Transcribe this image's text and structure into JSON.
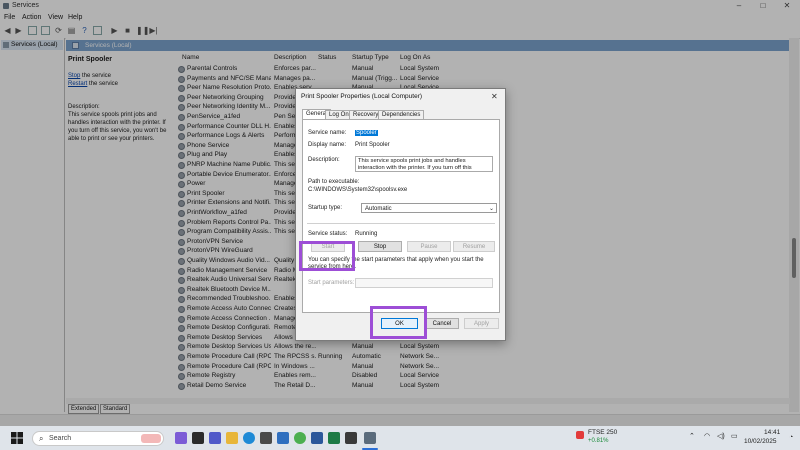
{
  "window": {
    "title": "Services",
    "controls": [
      "–",
      "□",
      "✕"
    ]
  },
  "menu": [
    "File",
    "Action",
    "View",
    "Help"
  ],
  "tree": {
    "root": "Services (Local)"
  },
  "pane": {
    "header": "Services (Local)"
  },
  "extended": {
    "service_name": "Print Spooler",
    "stop_link": "Stop",
    "stop_suffix": " the service",
    "restart_link": "Restart",
    "restart_suffix": " the service",
    "description_label": "Description:",
    "description": "This service spools print jobs and handles interaction with the printer. If you turn off this service, you won't be able to print or see your printers."
  },
  "columns": [
    "Name",
    "Description",
    "Status",
    "Startup Type",
    "Log On As"
  ],
  "services": [
    {
      "name": "Parental Controls",
      "desc": "Enforces par...",
      "status": "",
      "startup": "Manual",
      "logon": "Local System"
    },
    {
      "name": "Payments and NFC/SE Mana...",
      "desc": "Manages pa...",
      "status": "",
      "startup": "Manual (Trigg...",
      "logon": "Local Service"
    },
    {
      "name": "Peer Name Resolution Proto...",
      "desc": "Enables serv...",
      "status": "",
      "startup": "Manual",
      "logon": "Local Service"
    },
    {
      "name": "Peer Networking Grouping",
      "desc": "Provides ne...",
      "status": "",
      "startup": "Manual",
      "logon": "Local Service"
    },
    {
      "name": "Peer Networking Identity M...",
      "desc": "Provides ide...",
      "status": "",
      "startup": "Manual",
      "logon": "Local Service"
    },
    {
      "name": "PenService_a1fed",
      "desc": "Pen Service",
      "status": "",
      "startup": "",
      "logon": ""
    },
    {
      "name": "Performance Counter DLL H...",
      "desc": "Enables rem...",
      "status": "",
      "startup": "",
      "logon": ""
    },
    {
      "name": "Performance Logs & Alerts",
      "desc": "Performance...",
      "status": "",
      "startup": "",
      "logon": ""
    },
    {
      "name": "Phone Service",
      "desc": "Manages th...",
      "status": "",
      "startup": "",
      "logon": ""
    },
    {
      "name": "Plug and Play",
      "desc": "Enables a co...",
      "status": "",
      "startup": "",
      "logon": ""
    },
    {
      "name": "PNRP Machine Name Public...",
      "desc": "This service ...",
      "status": "",
      "startup": "",
      "logon": ""
    },
    {
      "name": "Portable Device Enumerator...",
      "desc": "Enforces gr...",
      "status": "",
      "startup": "",
      "logon": ""
    },
    {
      "name": "Power",
      "desc": "Manages po...",
      "status": "",
      "startup": "",
      "logon": ""
    },
    {
      "name": "Print Spooler",
      "desc": "This service ...",
      "status": "",
      "startup": "",
      "logon": ""
    },
    {
      "name": "Printer Extensions and Notifi...",
      "desc": "This service ...",
      "status": "",
      "startup": "",
      "logon": ""
    },
    {
      "name": "PrintWorkflow_a1fed",
      "desc": "Provides su...",
      "status": "",
      "startup": "",
      "logon": ""
    },
    {
      "name": "Problem Reports Control Pa...",
      "desc": "This service ...",
      "status": "",
      "startup": "",
      "logon": ""
    },
    {
      "name": "Program Compatibility Assis...",
      "desc": "This service ...",
      "status": "",
      "startup": "",
      "logon": ""
    },
    {
      "name": "ProtonVPN Service",
      "desc": "",
      "status": "",
      "startup": "",
      "logon": ""
    },
    {
      "name": "ProtonVPN WireGuard",
      "desc": "",
      "status": "",
      "startup": "",
      "logon": ""
    },
    {
      "name": "Quality Windows Audio Vid...",
      "desc": "Quality Win...",
      "status": "",
      "startup": "",
      "logon": ""
    },
    {
      "name": "Radio Management Service",
      "desc": "Radio Mana...",
      "status": "",
      "startup": "",
      "logon": ""
    },
    {
      "name": "Realtek Audio Universal Serv...",
      "desc": "Realtek Aud...",
      "status": "",
      "startup": "",
      "logon": ""
    },
    {
      "name": "Realtek Bluetooth Device M...",
      "desc": "",
      "status": "",
      "startup": "",
      "logon": ""
    },
    {
      "name": "Recommended Troubleshoo...",
      "desc": "Enables aut...",
      "status": "",
      "startup": "",
      "logon": ""
    },
    {
      "name": "Remote Access Auto Connec...",
      "desc": "Creates a co...",
      "status": "",
      "startup": "",
      "logon": ""
    },
    {
      "name": "Remote Access Connection ...",
      "desc": "Manages di...",
      "status": "",
      "startup": "",
      "logon": ""
    },
    {
      "name": "Remote Desktop Configurati...",
      "desc": "Remote Des...",
      "status": "",
      "startup": "",
      "logon": ""
    },
    {
      "name": "Remote Desktop Services",
      "desc": "Allows users ...",
      "status": "",
      "startup": "Manual",
      "logon": "Network Se..."
    },
    {
      "name": "Remote Desktop Services Us...",
      "desc": "Allows the re...",
      "status": "",
      "startup": "Manual",
      "logon": "Local System"
    },
    {
      "name": "Remote Procedure Call (RPC)",
      "desc": "The RPCSS s...",
      "status": "Running",
      "startup": "Automatic",
      "logon": "Network Se..."
    },
    {
      "name": "Remote Procedure Call (RPC)...",
      "desc": "In Windows ...",
      "status": "",
      "startup": "Manual",
      "logon": "Network Se..."
    },
    {
      "name": "Remote Registry",
      "desc": "Enables rem...",
      "status": "",
      "startup": "Disabled",
      "logon": "Local Service"
    },
    {
      "name": "Retail Demo Service",
      "desc": "The Retail D...",
      "status": "",
      "startup": "Manual",
      "logon": "Local System"
    }
  ],
  "bottom_tabs": [
    "Extended",
    "Standard"
  ],
  "dialog": {
    "title": "Print Spooler Properties (Local Computer)",
    "close": "✕",
    "tabs": [
      "General",
      "Log On",
      "Recovery",
      "Dependencies"
    ],
    "service_name_label": "Service name:",
    "service_name": "Spooler",
    "display_name_label": "Display name:",
    "display_name": "Print Spooler",
    "description_label": "Description:",
    "description": "This service spools print jobs and handles interaction with the printer. If you turn off this service, you won't be able to print or see your printers.",
    "path_label": "Path to executable:",
    "path": "C:\\WINDOWS\\System32\\spoolsv.exe",
    "startup_label": "Startup type:",
    "startup_value": "Automatic",
    "status_label": "Service status:",
    "status_value": "Running",
    "buttons": {
      "start": "Start",
      "stop": "Stop",
      "pause": "Pause",
      "resume": "Resume"
    },
    "hint": "You can specify the start parameters that apply when you start the service from here.",
    "params_label": "Start parameters:",
    "ok": "OK",
    "cancel": "Cancel",
    "apply": "Apply"
  },
  "taskbar": {
    "search": "Search",
    "stock_name": "FTSE 250",
    "stock_change": "+0.81%",
    "time": "14:41",
    "date": "10/02/2025"
  },
  "colors": {
    "highlight": "#9d4ed6",
    "pane_header": "#7ca4cf",
    "link": "#0645ad"
  }
}
